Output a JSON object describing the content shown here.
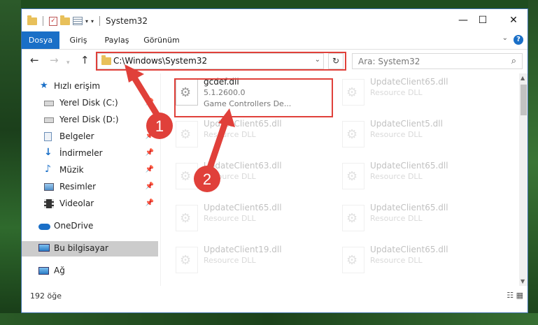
{
  "window": {
    "title": "System32",
    "controls": {
      "minimize": "—",
      "maximize": "☐",
      "close": "✕"
    }
  },
  "ribbon": {
    "tabs": [
      "Dosya",
      "Giriş",
      "Paylaş",
      "Görünüm"
    ],
    "help": "?"
  },
  "address": {
    "path": "C:\\Windows\\System32",
    "search_placeholder": "Ara: System32"
  },
  "sidebar": {
    "items": [
      {
        "label": "Hızlı erişim",
        "icon": "star-icon"
      },
      {
        "label": "Yerel Disk (C:)",
        "icon": "drive-icon",
        "pinned": true
      },
      {
        "label": "Yerel Disk (D:)",
        "icon": "drive-icon"
      },
      {
        "label": "Belgeler",
        "icon": "documents-icon",
        "pinned": true
      },
      {
        "label": "İndirmeler",
        "icon": "download-icon",
        "pinned": true
      },
      {
        "label": "Müzik",
        "icon": "music-icon",
        "pinned": true
      },
      {
        "label": "Resimler",
        "icon": "pictures-icon",
        "pinned": true
      },
      {
        "label": "Videolar",
        "icon": "videos-icon",
        "pinned": true
      },
      {
        "label": "OneDrive",
        "icon": "cloud-icon"
      },
      {
        "label": "Bu bilgisayar",
        "icon": "computer-icon",
        "selected": true
      },
      {
        "label": "Ağ",
        "icon": "network-icon"
      }
    ]
  },
  "files": [
    {
      "name": "gcdef.dll",
      "line2": "5.1.2600.0",
      "line3": "Game Controllers De..."
    },
    {
      "name": "UpdateClient65.dll",
      "line2": "Resource DLL"
    },
    {
      "name": "UpdateClient65.dll",
      "line2": "Resource DLL"
    },
    {
      "name": "UpdateClient5.dll",
      "line2": "Resource DLL"
    },
    {
      "name": "UpdateClient63.dll",
      "line2": "Resource DLL"
    },
    {
      "name": "UpdateClient65.dll",
      "line2": "Resource DLL"
    },
    {
      "name": "UpdateClient65.dll",
      "line2": "Resource DLL"
    },
    {
      "name": "UpdateClient65.dll",
      "line2": "Resource DLL"
    },
    {
      "name": "UpdateClient19.dll",
      "line2": "Resource DLL"
    },
    {
      "name": "UpdateClient65.dll",
      "line2": "Resource DLL"
    }
  ],
  "status": {
    "count": "192 öğe"
  },
  "annotations": {
    "step1": "1",
    "step2": "2"
  },
  "colors": {
    "accent": "#1a6fc7",
    "annotation": "#e0403a"
  }
}
